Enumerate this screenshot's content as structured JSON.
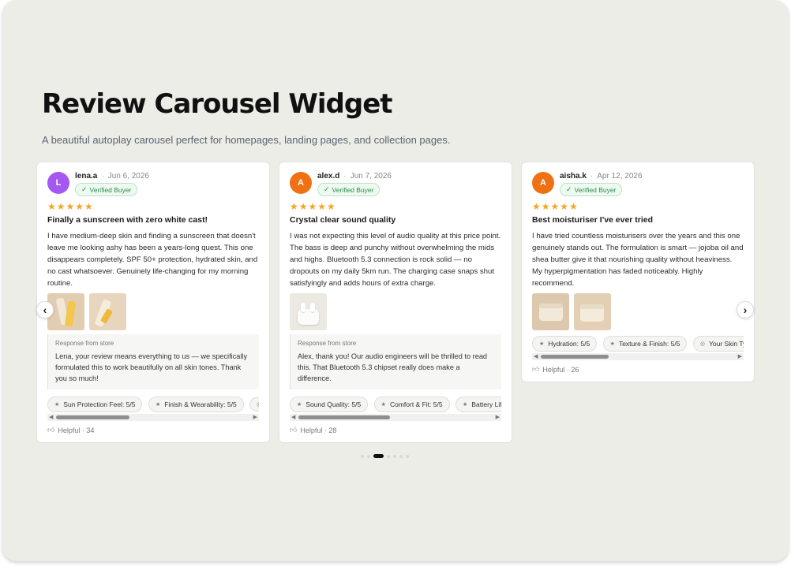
{
  "page": {
    "title": "Review Carousel Widget",
    "subtitle": "A beautiful autoplay carousel perfect for homepages, landing pages, and collection pages."
  },
  "colors": {
    "background": "#ecede6",
    "star": "#f5a524",
    "verified_green": "#2f8a4e",
    "avatar_purple": "#a557f2",
    "avatar_orange": "#f07014"
  },
  "reviews": [
    {
      "initial": "L",
      "name": "lena.a",
      "date": "Jun 6, 2026",
      "verified": "Verified Buyer",
      "stars": "★★★★★",
      "rating": 5,
      "heading": "Finally a sunscreen with zero white cast!",
      "body": "I have medium-deep skin and finding a sunscreen that doesn't leave me looking ashy has been a years-long quest. This one disappears completely. SPF 50+ protection, hydrated skin, and no cast whatsoever. Genuinely life-changing for my morning routine.",
      "response_label": "Response from store",
      "response": "Lena, your review means everything to us — we specifically formulated this to work beautifully on all skin tones. Thank you so much!",
      "chips": [
        "Sun Protection Feel: 5/5",
        "Finish & Wearability: 5/5"
      ],
      "helpful": "Helpful · 34"
    },
    {
      "initial": "A",
      "name": "alex.d",
      "date": "Jun 7, 2026",
      "verified": "Verified Buyer",
      "stars": "★★★★★",
      "rating": 5,
      "heading": "Crystal clear sound quality",
      "body": "I was not expecting this level of audio quality at this price point. The bass is deep and punchy without overwhelming the mids and highs. Bluetooth 5.3 connection is rock solid — no dropouts on my daily 5km run. The charging case snaps shut satisfyingly and adds hours of extra charge.",
      "response_label": "Response from store",
      "response": "Alex, thank you! Our audio engineers will be thrilled to read this. That Bluetooth 5.3 chipset really does make a difference.",
      "chips": [
        "Sound Quality: 5/5",
        "Comfort & Fit: 5/5",
        "Battery Life:"
      ],
      "helpful": "Helpful · 28"
    },
    {
      "initial": "A",
      "name": "aisha.k",
      "date": "Apr 12, 2026",
      "verified": "Verified Buyer",
      "stars": "★★★★★",
      "rating": 5,
      "heading": "Best moisturiser I've ever tried",
      "body": "I have tried countless moisturisers over the years and this one genuinely stands out. The formulation is smart — jojoba oil and shea butter give it that nourishing quality without heaviness. My hyperpigmentation has faded noticeably. Highly recommend.",
      "chips": [
        "Hydration: 5/5",
        "Texture & Finish: 5/5",
        "Your Skin Typ"
      ],
      "helpful": "Helpful · 26"
    }
  ],
  "pager": {
    "count": 7,
    "active_index": 2
  }
}
